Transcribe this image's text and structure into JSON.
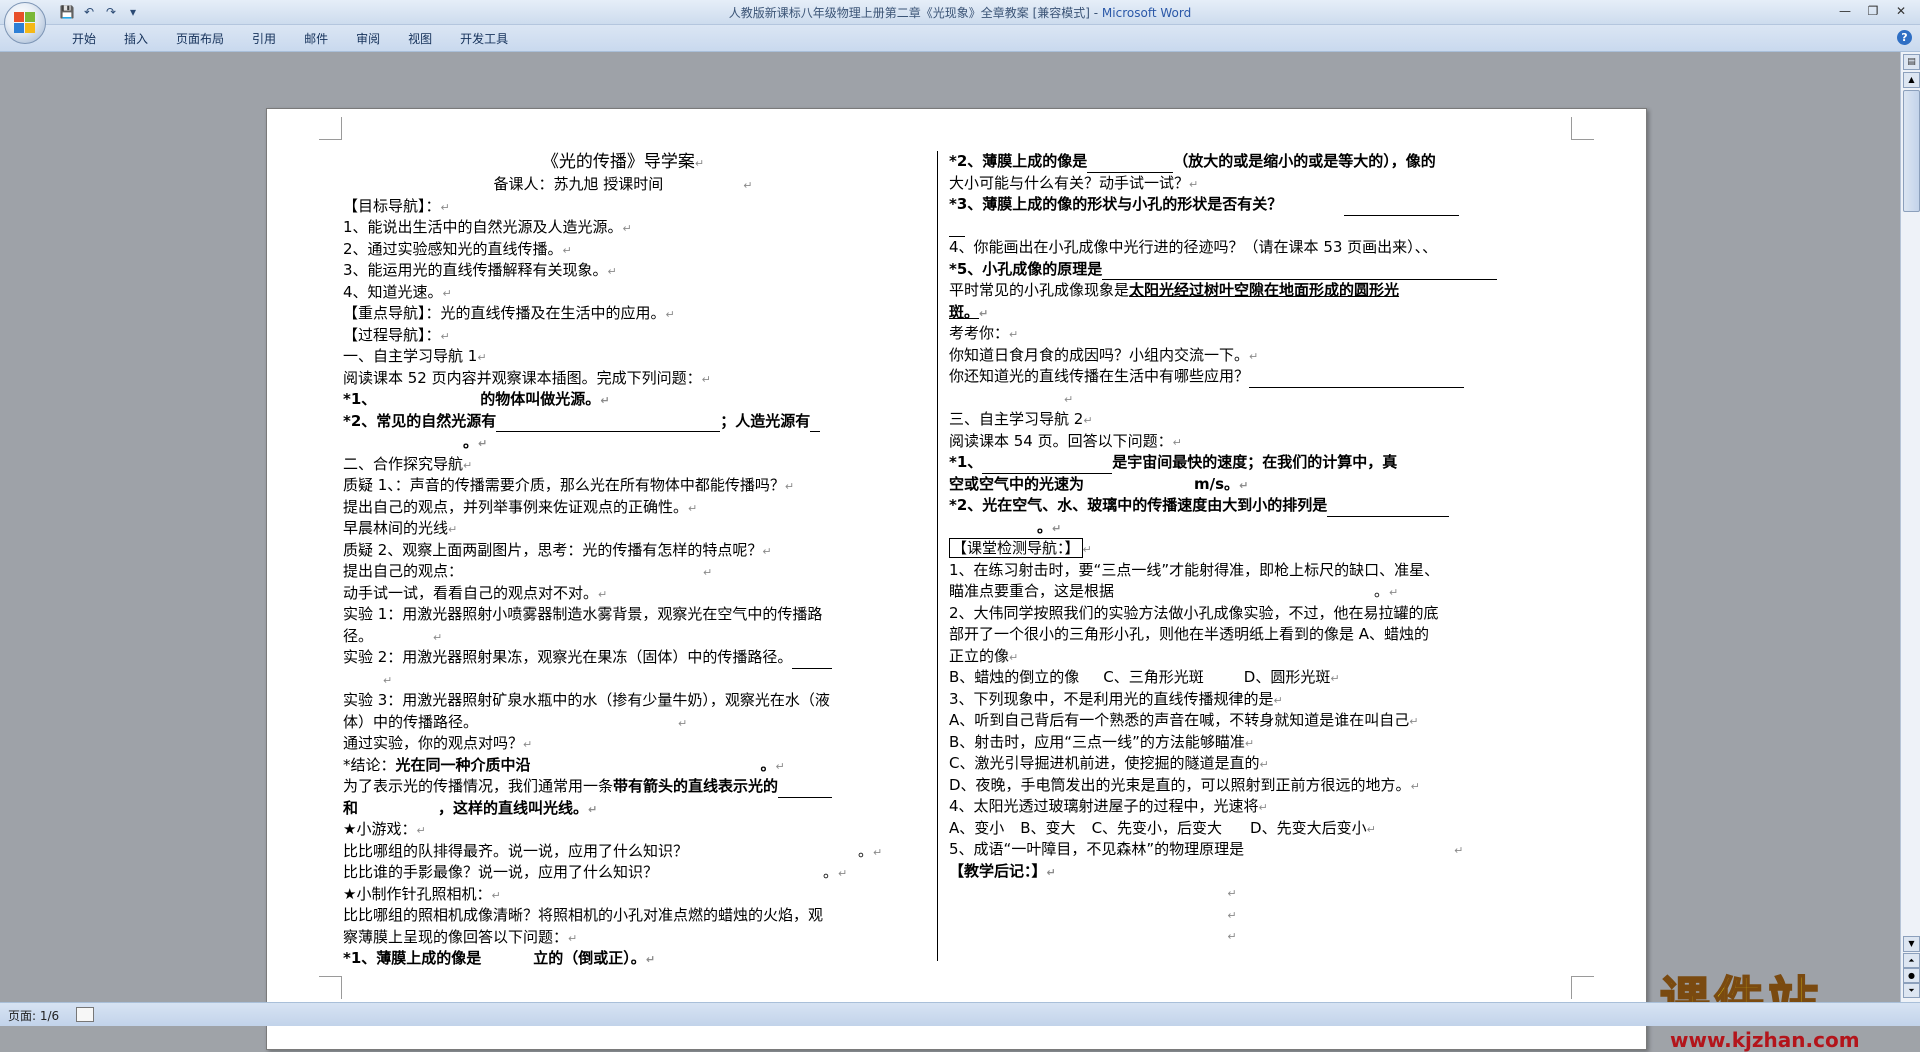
{
  "window": {
    "title": "人教版新课标八年级物理上册第二章《光现象》全章教案 [兼容模式] - ",
    "app_name": "Microsoft Word",
    "controls": {
      "minimize": "—",
      "restore": "❐",
      "close": "✕"
    }
  },
  "qat": {
    "save_icon": "💾",
    "undo_icon": "↶",
    "redo_icon": "↷",
    "more_icon": "▾"
  },
  "ribbon": {
    "tabs": [
      "开始",
      "插入",
      "页面布局",
      "引用",
      "邮件",
      "审阅",
      "视图",
      "开发工具"
    ],
    "help_icon": "?"
  },
  "document": {
    "left": {
      "title": "《光的传播》导学案",
      "subtitle": "备课人：苏九旭      授课时间",
      "lines": [
        "【目标导航】：",
        "1、能说出生活中的自然光源及人造光源。",
        "2、通过实验感知光的直线传播。",
        "3、能运用光的直线传播解释有关现象。",
        "4、知道光速。",
        "【重点导航】：光的直线传播及在生活中的应用。",
        "【过程导航】：",
        "一、自主学习导航 1",
        "阅读课本 52 页内容并观察课本插图。完成下列问题：",
        "*1、",
        "的物体叫做光源。",
        "*2、常见的自然光源有",
        "；人造光源有",
        "二、合作探究导航",
        "质疑 1、：声音的传播需要介质，那么光在所有物体中都能传播吗？",
        "提出自己的观点，并列举事例来佐证观点的正确性。",
        "早晨林间的光线",
        "质疑 2、观察上面两副图片，思考：光的传播有怎样的特点呢？",
        "提出自己的观点：",
        "动手试一试，看看自己的观点对不对。",
        "实验 1：用激光器照射小喷雾器制造水雾背景，观察光在空气中的传播路",
        "径。",
        "实验 2：用激光器照射果冻，观察光在果冻（固体）中的传播路径。",
        "实验 3：用激光器照射矿泉水瓶中的水（掺有少量牛奶），观察光在水（液",
        "体）中的传播路径。",
        "通过实验，你的观点对吗？",
        "*结论：",
        "光在同一种介质中沿",
        "为了表示光的传播情况，我们通常用一条",
        "带有箭头的直线表示光的",
        "和",
        "，这样的直线叫光线。",
        "★小游戏：",
        "比比哪组的队排得最齐。说一说，应用了什么知识？",
        "比比谁的手影最像？说一说，应用了什么知识？",
        "★小制作针孔照相机：",
        "比比哪组的照相机成像清晰？将照相机的小孔对准点燃的蜡烛的火焰，观",
        "察薄膜上呈现的像回答以下问题：",
        "*1、薄膜上成的像是",
        "立的（倒或正）。"
      ]
    },
    "right": {
      "lines": [
        "*2、薄膜上成的像是",
        "（放大的或是缩小的或是等大的），像的",
        "大小可能与什么有关？动手试一试？",
        "*3、薄膜上成的像的形状与小孔的形状是否有关？",
        "4、你能画出在小孔成像中光行进的径迹吗？（请在课本 53 页画出来）、、",
        "*5、小孔成像的原理是",
        "平时常见的小孔成像现象是",
        "太阳光经过树叶空隙在地面形成的圆形光",
        "斑。",
        "考考你：",
        "你知道日食月食的成因吗？小组内交流一下。",
        "你还知道光的直线传播在生活中有哪些应用？",
        "三、自主学习导航 2",
        "阅读课本 54 页。回答以下问题：",
        "*1、",
        "是宇宙间最快的速度；在我们的计算中，真",
        "空或空气中的光速为",
        "m/s。",
        "*2、光在空气、水、玻璃中的传播速度由大到小的排列是",
        "【课堂检测导航：】",
        "1、在练习射击时，要“三点一线”才能射得准，即枪上标尺的缺口、准星、",
        "瞄准点要重合，这是根据",
        "2、大伟同学按照我们的实验方法做小孔成像实验，不过，他在易拉罐的底",
        "部开了一个很小的三角形小孔，则他在半透明纸上看到的像是 A、蜡烛的",
        "正立的像",
        "B、蜡烛的倒立的像",
        "C、三角形光斑",
        "D、圆形光斑",
        "3、下列现象中，不是利用光的直线传播规律的是",
        "A、听到自己背后有一个熟悉的声音在喊，不转身就知道是谁在叫自己",
        "B、射击时，应用“三点一线”的方法能够瞄准",
        "C、激光引导掘进机前进，使挖掘的隧道是直的",
        "D、夜晚，手电筒发出的光束是直的，可以照射到正前方很远的地方。",
        "4、太阳光透过玻璃射进屋子的过程中，光速将",
        "A、变小",
        "B、变大",
        "C、先变小，后变大",
        "D、先变大后变小",
        "5、成语“一叶障目，不见森林”的物理原理是",
        "【教学后记：】"
      ]
    },
    "paragraph_mark": "↵"
  },
  "status": {
    "page": "页面: 1/6"
  },
  "watermark": {
    "brand": "课件站",
    "url": "www.kjzhan.com"
  },
  "scrollbar": {
    "ruler_icon": "▤",
    "up": "▲",
    "down": "▼",
    "prev": "⏶",
    "browse": "●",
    "next": "⏷"
  }
}
